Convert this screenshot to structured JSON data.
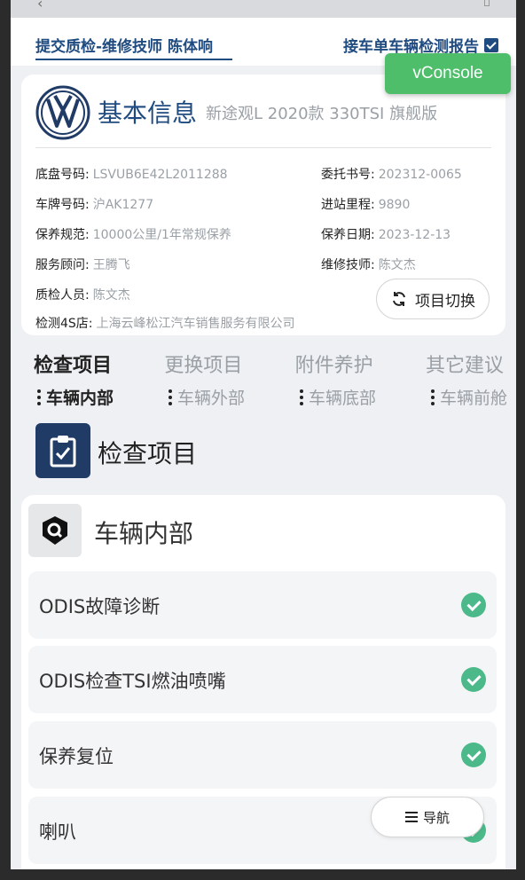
{
  "header": {
    "left_tab": "提交质检-维修技师 陈体响",
    "right_tab": "接车单车辆检测报告"
  },
  "vconsole": {
    "label": "vConsole"
  },
  "basic_info": {
    "title": "基本信息",
    "subtitle": "新途观L 2020款 330TSI 旗舰版",
    "fields": [
      {
        "key": "底盘号码:",
        "value": "LSVUB6E42L2011288"
      },
      {
        "key": "委托书号:",
        "value": "202312-0065"
      },
      {
        "key": "车牌号码:",
        "value": "沪AK1277"
      },
      {
        "key": "进站里程:",
        "value": "9890"
      },
      {
        "key": "保养规范:",
        "value": "10000公里/1年常规保养"
      },
      {
        "key": "保养日期:",
        "value": "2023-12-13"
      },
      {
        "key": "服务顾问:",
        "value": "王腾飞"
      },
      {
        "key": "维修技师:",
        "value": "陈文杰"
      },
      {
        "key": "质检人员:",
        "value": "陈文杰"
      },
      {
        "key": "检测4S店:",
        "value": "上海云峰松江汽车销售服务有限公司"
      }
    ],
    "switch_button": "项目切换"
  },
  "category_tabs": [
    "检查项目",
    "更换项目",
    "附件养护",
    "其它建议"
  ],
  "sub_tabs": [
    "车辆内部",
    "车辆外部",
    "车辆底部",
    "车辆前舱"
  ],
  "section": {
    "title": "检查项目"
  },
  "list": {
    "category": "车辆内部",
    "items": [
      "ODIS故障诊断",
      "ODIS检查TSI燃油喷嘴",
      "保养复位",
      "喇叭"
    ]
  },
  "nav_button": "导航",
  "colors": {
    "primary": "#1f4b80",
    "success": "#4cb98a",
    "vconsole": "#4fbe6b"
  }
}
